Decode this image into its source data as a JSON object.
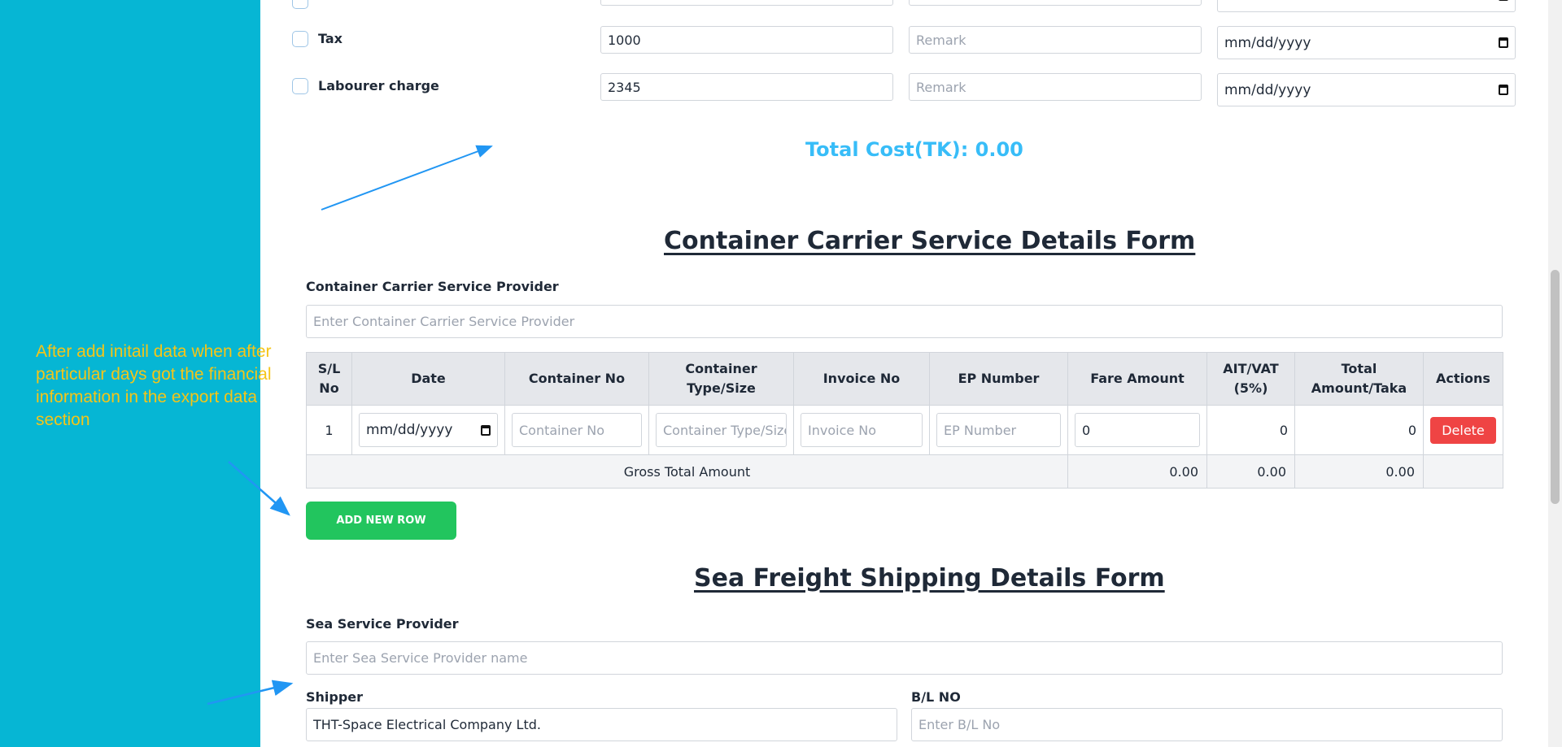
{
  "annotation": {
    "text": "After add initail data when after particular days got the financial information in the export data section"
  },
  "other_costs": {
    "date_placeholder": "mm/dd/yyyy",
    "rows": [
      {
        "label": "Tax",
        "amount": "1000",
        "remark_placeholder": "Remark"
      },
      {
        "label": "Labourer charge",
        "amount": "2345",
        "remark_placeholder": "Remark"
      }
    ],
    "total_cost": "Total Cost(TK): 0.00"
  },
  "container_form": {
    "title": "Container Carrier Service Details Form",
    "provider_label": "Container Carrier Service Provider",
    "provider_placeholder": "Enter Container Carrier Service Provider",
    "columns": [
      "S/L No",
      "Date",
      "Container No",
      "Container Type/Size",
      "Invoice No",
      "EP Number",
      "Fare Amount",
      "AIT/VAT (5%)",
      "Total Amount/Taka",
      "Actions"
    ],
    "row": {
      "sl": "1",
      "date": "mm/dd/yyyy",
      "container_no_placeholder": "Container No",
      "container_type_placeholder": "Container Type/Size",
      "invoice_placeholder": "Invoice No",
      "ep_placeholder": "EP Number",
      "fare_amount": "0",
      "ait_vat": "0",
      "total": "0",
      "delete_label": "Delete"
    },
    "gross": {
      "label": "Gross Total Amount",
      "fare": "0.00",
      "ait": "0.00",
      "total": "0.00"
    },
    "add_row_label": "ADD NEW ROW"
  },
  "sea_form": {
    "title": "Sea Freight Shipping Details Form",
    "provider_label": "Sea Service Provider",
    "provider_placeholder": "Enter Sea Service Provider name",
    "shipper_label": "Shipper",
    "shipper_value": "THT-Space Electrical Company Ltd.",
    "bl_label": "B/L NO",
    "bl_placeholder": "Enter B/L No"
  },
  "colors": {
    "sidebar": "#06b6d4",
    "annotation_text": "#f5c518",
    "arrow": "#2196f3",
    "total_cost": "#38bdf8",
    "add_button": "#22c55e",
    "delete_button": "#ef4444"
  }
}
